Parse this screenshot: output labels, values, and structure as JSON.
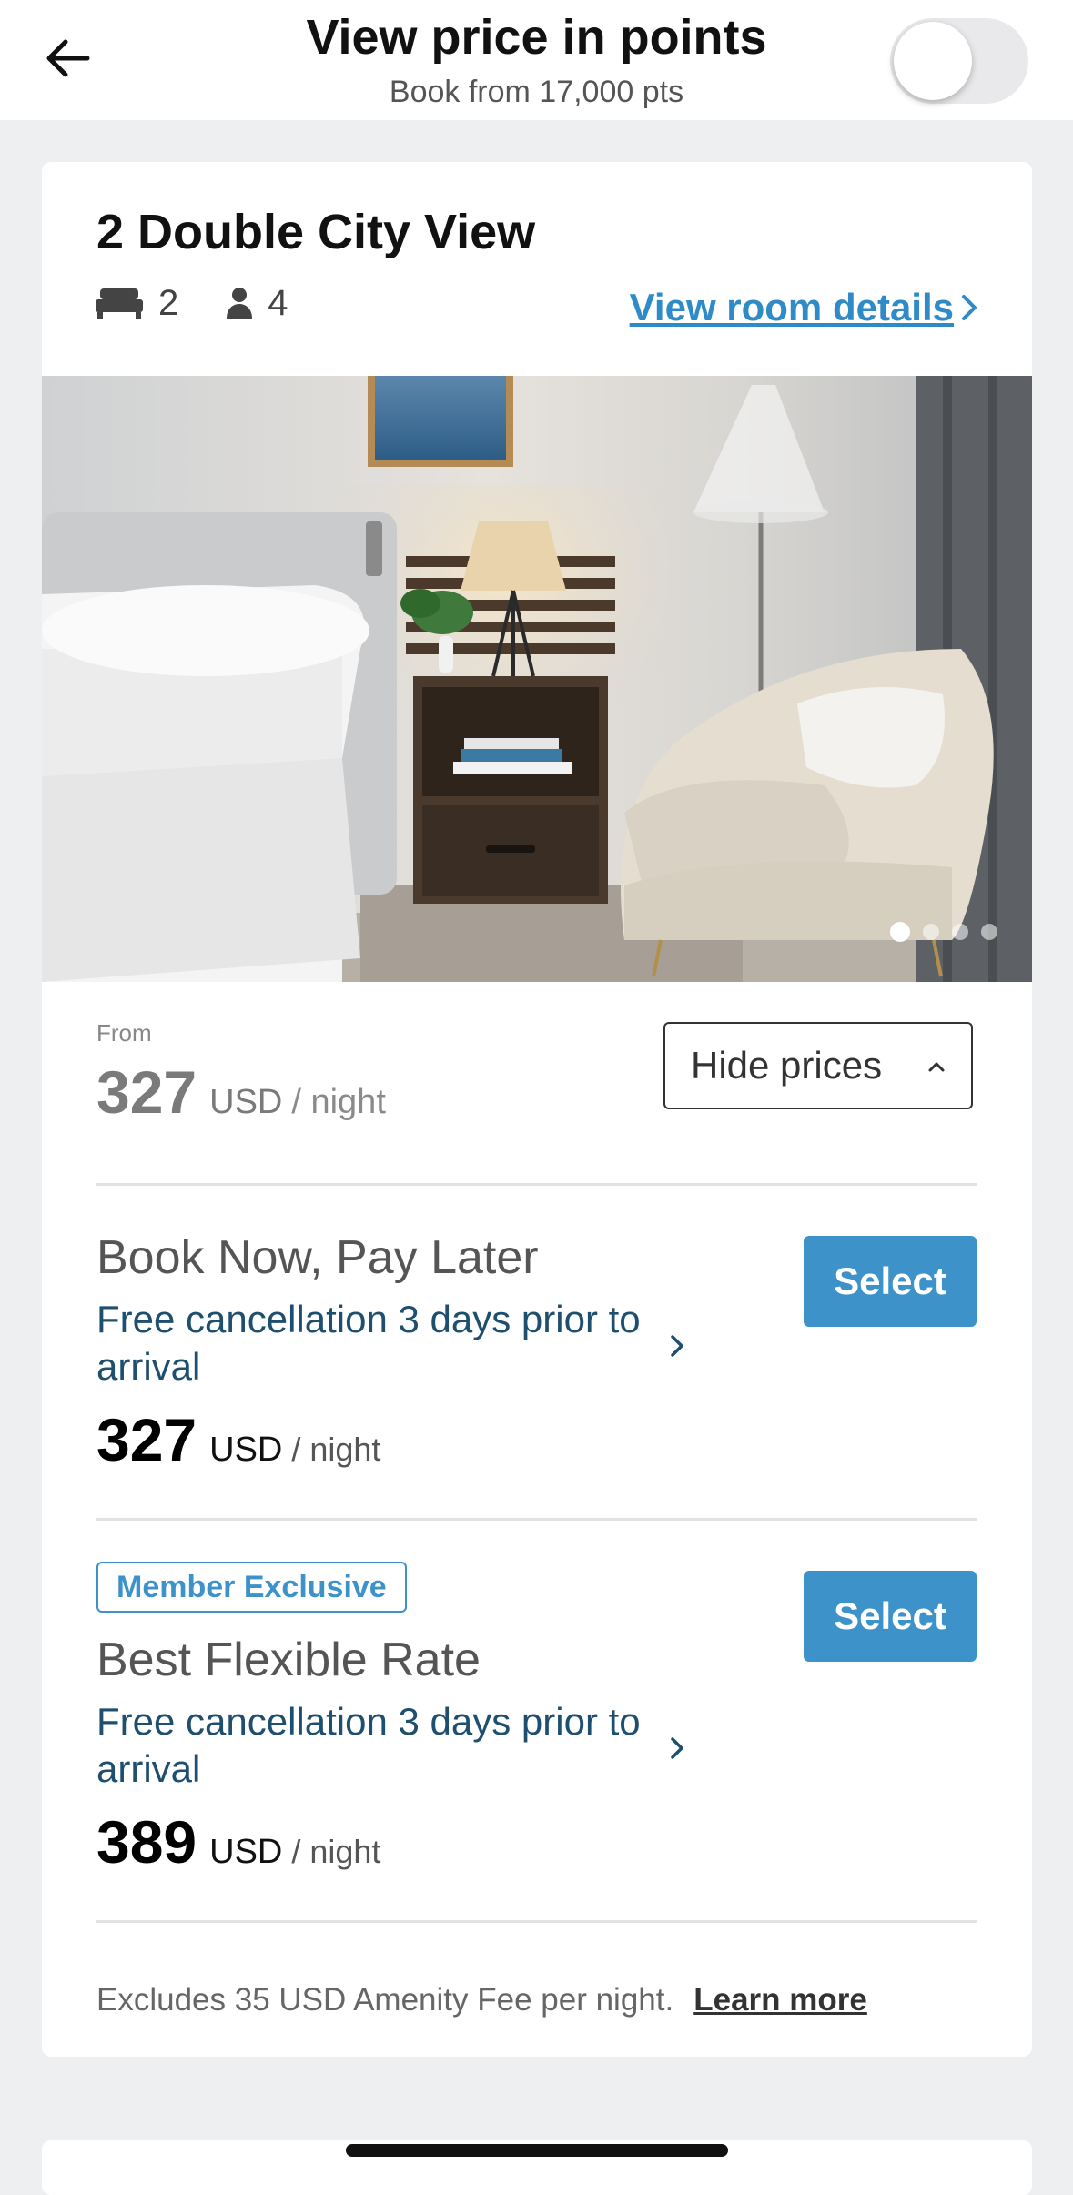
{
  "header": {
    "title": "View price in points",
    "subtitle": "Book from 17,000 pts",
    "points_toggle_on": false
  },
  "room": {
    "name": "2 Double City View",
    "beds": "2",
    "guests": "4",
    "details_link": "View room details",
    "photo_count": 4,
    "photo_index": 1
  },
  "pricing": {
    "from_label": "From",
    "from_amount": "327",
    "currency": "USD",
    "per_night": "/ night",
    "hide_prices_label": "Hide prices"
  },
  "rates": [
    {
      "badge": "",
      "name": "Book Now, Pay Later",
      "cancellation": "Free cancellation 3 days prior to arrival",
      "amount": "327",
      "currency": "USD",
      "per_night": "/ night",
      "select_label": "Select"
    },
    {
      "badge": "Member Exclusive",
      "name": "Best Flexible Rate",
      "cancellation": "Free cancellation 3 days prior to arrival",
      "amount": "389",
      "currency": "USD",
      "per_night": "/ night",
      "select_label": "Select"
    }
  ],
  "footer": {
    "note": "Excludes 35 USD Amenity Fee per night.",
    "learn_more": "Learn more"
  },
  "colors": {
    "accent": "#3d93c9",
    "link": "#2e8bc7",
    "cancel_text": "#1f4f6e",
    "background": "#eeeff1"
  }
}
